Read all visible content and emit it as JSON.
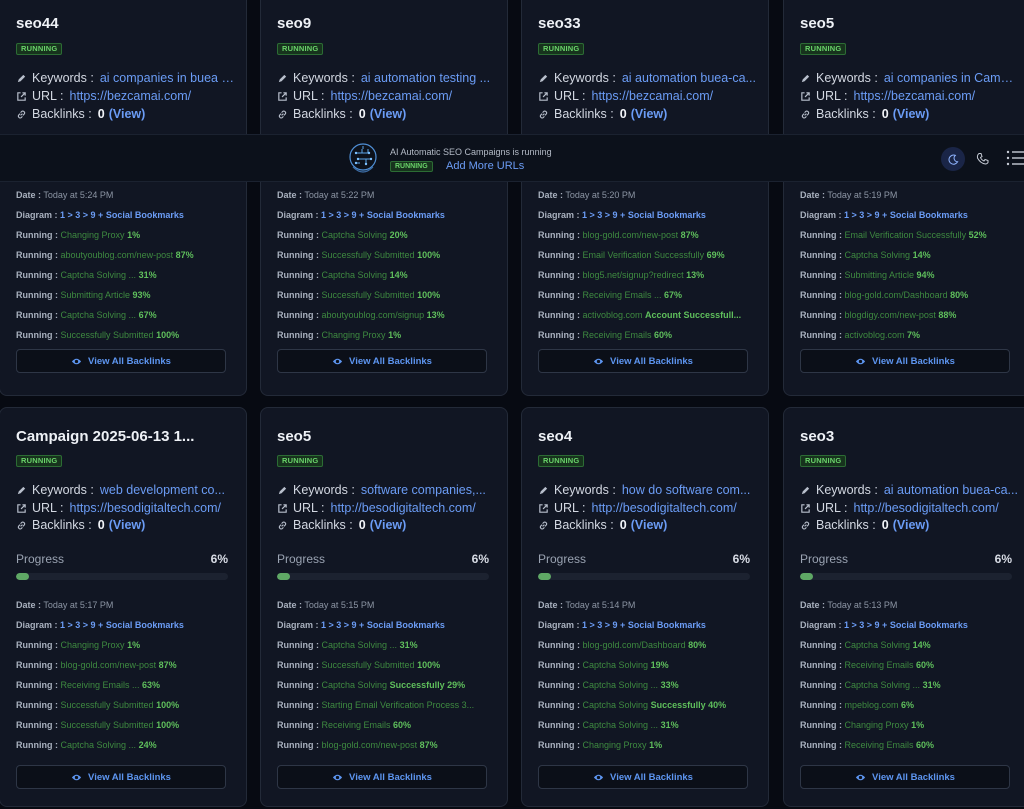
{
  "banner": {
    "message": "AI Automatic SEO Campaigns is running",
    "status": "RUNNING",
    "add_more": "Add More URLs"
  },
  "labels": {
    "keywords": "Keywords :",
    "url": "URL :",
    "backlinks": "Backlinks :",
    "view": "(View)",
    "progress": "Progress",
    "date": "Date :",
    "diagram": "Diagram :",
    "running": "Running :",
    "view_all": "View All Backlinks"
  },
  "colors": {
    "accent": "#6b9cf5",
    "running_green": "#6ad46a",
    "card_bg": "#111623",
    "page_bg": "#070a12"
  },
  "top_cards": [
    {
      "name": "seo44",
      "status": "RUNNING",
      "keywords": "ai companies in buea c...",
      "url": "https://bezcamai.com/",
      "backlinks": "0",
      "date": "Today at 5:24 PM",
      "diagram": "1 > 3 > 9 + Social Bookmarks",
      "running": [
        {
          "t": "Changing Proxy ",
          "p": "1%"
        },
        {
          "t": "aboutyoublog.com/new-post ",
          "p": "87%"
        },
        {
          "t": "Captcha Solving ... ",
          "p": "31%"
        },
        {
          "t": "Submitting Article ",
          "p": "93%"
        },
        {
          "t": "Captcha Solving ... ",
          "p": "67%"
        },
        {
          "t": "Successfully Submitted ",
          "p": "100%"
        }
      ]
    },
    {
      "name": "seo9",
      "status": "RUNNING",
      "keywords": "ai automation testing ...",
      "url": "https://bezcamai.com/",
      "backlinks": "0",
      "date": "Today at 5:22 PM",
      "diagram": "1 > 3 > 9 + Social Bookmarks",
      "running": [
        {
          "t": "Captcha Solving ",
          "p": "20%"
        },
        {
          "t": "Successfully Submitted ",
          "p": "100%"
        },
        {
          "t": "Captcha Solving ",
          "p": "14%"
        },
        {
          "t": "Successfully Submitted ",
          "p": "100%"
        },
        {
          "t": "aboutyoublog.com/signup ",
          "p": "13%"
        },
        {
          "t": "Changing Proxy ",
          "p": "1%"
        }
      ]
    },
    {
      "name": "seo33",
      "status": "RUNNING",
      "keywords": "ai automation buea-ca...",
      "url": "https://bezcamai.com/",
      "backlinks": "0",
      "date": "Today at 5:20 PM",
      "diagram": "1 > 3 > 9 + Social Bookmarks",
      "running": [
        {
          "t": "blog-gold.com/new-post ",
          "p": "87%"
        },
        {
          "t": "Email Verification Successfully ",
          "p": "69%"
        },
        {
          "t": "blog5.net/signup?redirect ",
          "p": "13%"
        },
        {
          "t": "Receiving Emails ... ",
          "p": "67%"
        },
        {
          "t": "activoblog.com ",
          "p": "Account Successfull..."
        },
        {
          "t": "Receiving Emails ",
          "p": "60%"
        }
      ]
    },
    {
      "name": "seo5",
      "status": "RUNNING",
      "keywords": "ai companies in Camer...",
      "url": "https://bezcamai.com/",
      "backlinks": "0",
      "date": "Today at 5:19 PM",
      "diagram": "1 > 3 > 9 + Social Bookmarks",
      "running": [
        {
          "t": "Email Verification Successfully ",
          "p": "52%"
        },
        {
          "t": "Captcha Solving ",
          "p": "14%"
        },
        {
          "t": "Submitting Article ",
          "p": "94%"
        },
        {
          "t": "blog-gold.com/Dashboard ",
          "p": "80%"
        },
        {
          "t": "blogdigy.com/new-post ",
          "p": "88%"
        },
        {
          "t": "activoblog.com ",
          "p": "7%"
        }
      ]
    }
  ],
  "bottom_cards": [
    {
      "name": "Campaign 2025-06-13 1...",
      "status": "RUNNING",
      "keywords": "web development co...",
      "url": "https://besodigitaltech.com/",
      "backlinks": "0",
      "progress": 0.06,
      "progress_text": "6%",
      "date": "Today at 5:17 PM",
      "diagram": "1 > 3 > 9 + Social Bookmarks",
      "running": [
        {
          "t": "Changing Proxy ",
          "p": "1%"
        },
        {
          "t": "blog-gold.com/new-post ",
          "p": "87%"
        },
        {
          "t": "Receiving Emails ... ",
          "p": "63%"
        },
        {
          "t": "Successfully Submitted ",
          "p": "100%"
        },
        {
          "t": "Successfully Submitted ",
          "p": "100%"
        },
        {
          "t": "Captcha Solving ... ",
          "p": "24%"
        }
      ]
    },
    {
      "name": "seo5",
      "status": "RUNNING",
      "keywords": "software companies,...",
      "url": "http://besodigitaltech.com/",
      "backlinks": "0",
      "progress": 0.06,
      "progress_text": "6%",
      "date": "Today at 5:15 PM",
      "diagram": "1 > 3 > 9 + Social Bookmarks",
      "running": [
        {
          "t": "Captcha Solving ... ",
          "p": "31%"
        },
        {
          "t": "Successfully Submitted ",
          "p": "100%"
        },
        {
          "t": "Captcha Solving ",
          "p": "Successfully 29%"
        },
        {
          "t": "Starting Email Verification Process 3...",
          "p": ""
        },
        {
          "t": "Receiving Emails ",
          "p": "60%"
        },
        {
          "t": "blog-gold.com/new-post ",
          "p": "87%"
        }
      ]
    },
    {
      "name": "seo4",
      "status": "RUNNING",
      "keywords": "how do software com...",
      "url": "http://besodigitaltech.com/",
      "backlinks": "0",
      "progress": 0.06,
      "progress_text": "6%",
      "date": "Today at 5:14 PM",
      "diagram": "1 > 3 > 9 + Social Bookmarks",
      "running": [
        {
          "t": "blog-gold.com/Dashboard ",
          "p": "80%"
        },
        {
          "t": "Captcha Solving ",
          "p": "19%"
        },
        {
          "t": "Captcha Solving ... ",
          "p": "33%"
        },
        {
          "t": "Captcha Solving ",
          "p": "Successfully 40%"
        },
        {
          "t": "Captcha Solving ... ",
          "p": "31%"
        },
        {
          "t": "Changing Proxy ",
          "p": "1%"
        }
      ]
    },
    {
      "name": "seo3",
      "status": "RUNNING",
      "keywords": "ai automation buea-ca...",
      "url": "http://besodigitaltech.com/",
      "backlinks": "0",
      "progress": 0.06,
      "progress_text": "6%",
      "date": "Today at 5:13 PM",
      "diagram": "1 > 3 > 9 + Social Bookmarks",
      "running": [
        {
          "t": "Captcha Solving ",
          "p": "14%"
        },
        {
          "t": "Receiving Emails ",
          "p": "60%"
        },
        {
          "t": "Captcha Solving ... ",
          "p": "31%"
        },
        {
          "t": "mpeblog.com ",
          "p": "6%"
        },
        {
          "t": "Changing Proxy ",
          "p": "1%"
        },
        {
          "t": "Receiving Emails ",
          "p": "60%"
        }
      ]
    }
  ]
}
